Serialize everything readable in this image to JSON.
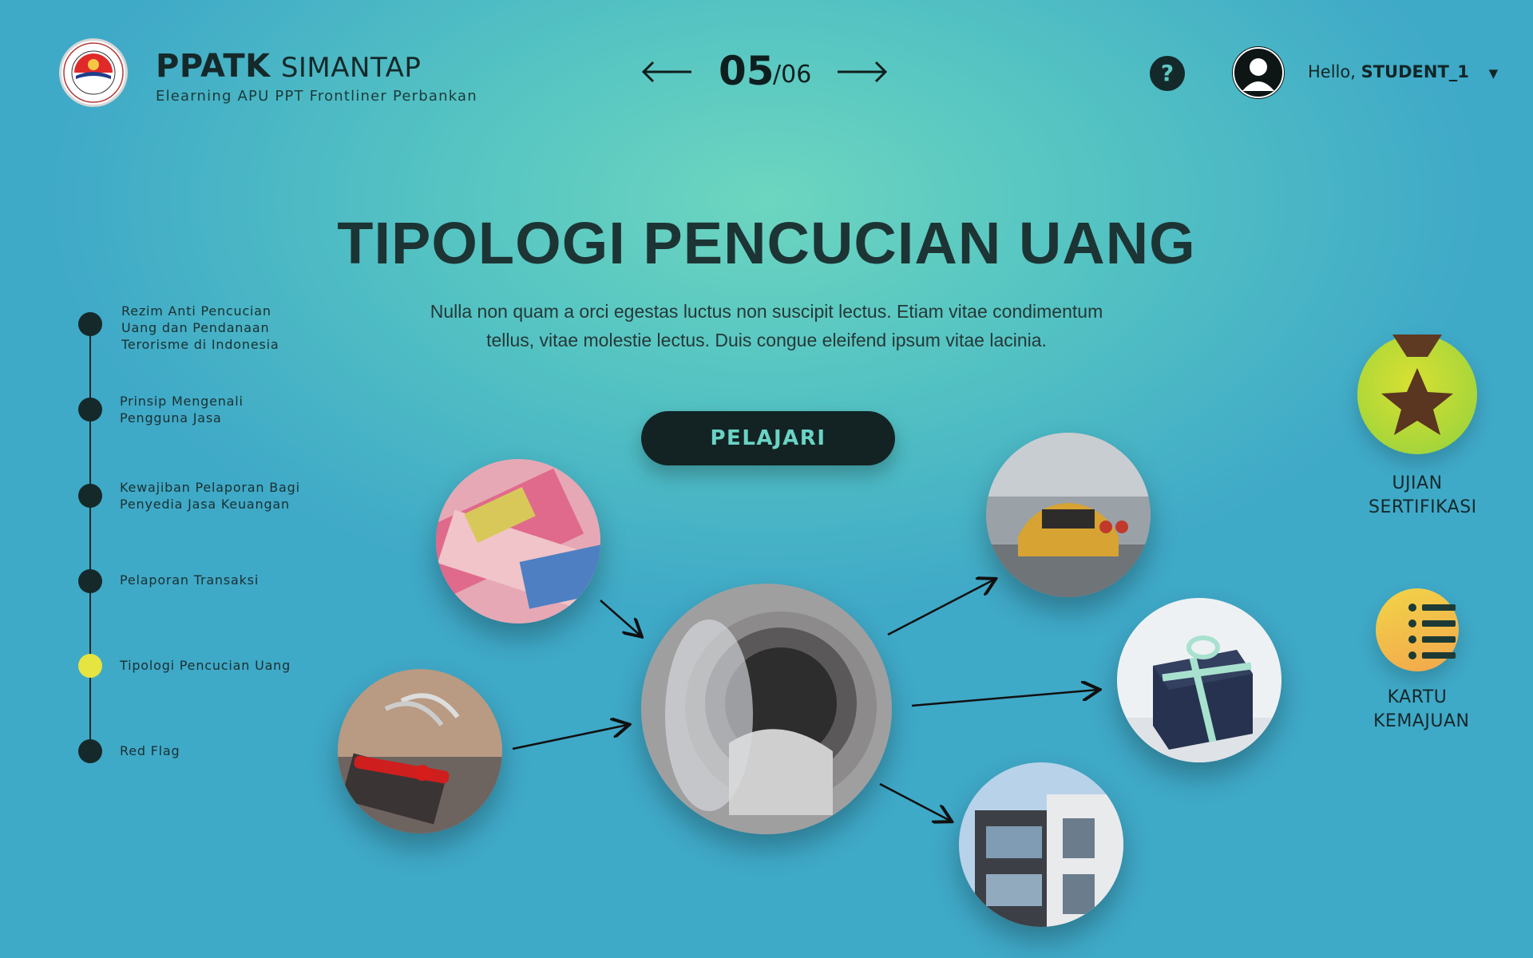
{
  "header": {
    "brand_bold": "PPATK",
    "brand_light": "SIMANTAP",
    "subtitle": "Elearning APU PPT Frontliner Perbankan",
    "pager": {
      "current": "05",
      "total": "/06"
    },
    "help_label": "?",
    "greeting": "Hello,",
    "username": "STUDENT_1"
  },
  "main": {
    "title": "TIPOLOGI PENCUCIAN UANG",
    "description": "Nulla non quam a orci egestas luctus non suscipit lectus. Etiam vitae condimentum tellus, vitae molestie lectus. Duis congue eleifend ipsum vitae lacinia.",
    "button_label": "PELAJARI"
  },
  "timeline": {
    "items": [
      {
        "label": "Rezim Anti Pencucian Uang dan Pendanaan Terorisme di Indonesia",
        "active": false
      },
      {
        "label": "Prinsip Mengenali Pengguna Jasa",
        "active": false
      },
      {
        "label": "Kewajiban Pelaporan Bagi Penyedia Jasa Keuangan",
        "active": false
      },
      {
        "label": "Pelaporan Transaksi",
        "active": false
      },
      {
        "label": "Tipologi Pencucian Uang",
        "active": true
      },
      {
        "label": "Red Flag",
        "active": false
      }
    ]
  },
  "actions": {
    "certification_label": "UJIAN SERTIFIKASI",
    "progress_label": "KARTU KEMAJUAN"
  },
  "icons": [
    "ppatk-logo",
    "arrow-left-icon",
    "arrow-right-icon",
    "help-icon",
    "user-avatar-icon",
    "chevron-down-icon",
    "medal-star-icon",
    "checklist-icon"
  ],
  "colors": {
    "accent_dark": "#15292a",
    "active_dot": "#e6e440",
    "button_text": "#6ad3c4"
  }
}
